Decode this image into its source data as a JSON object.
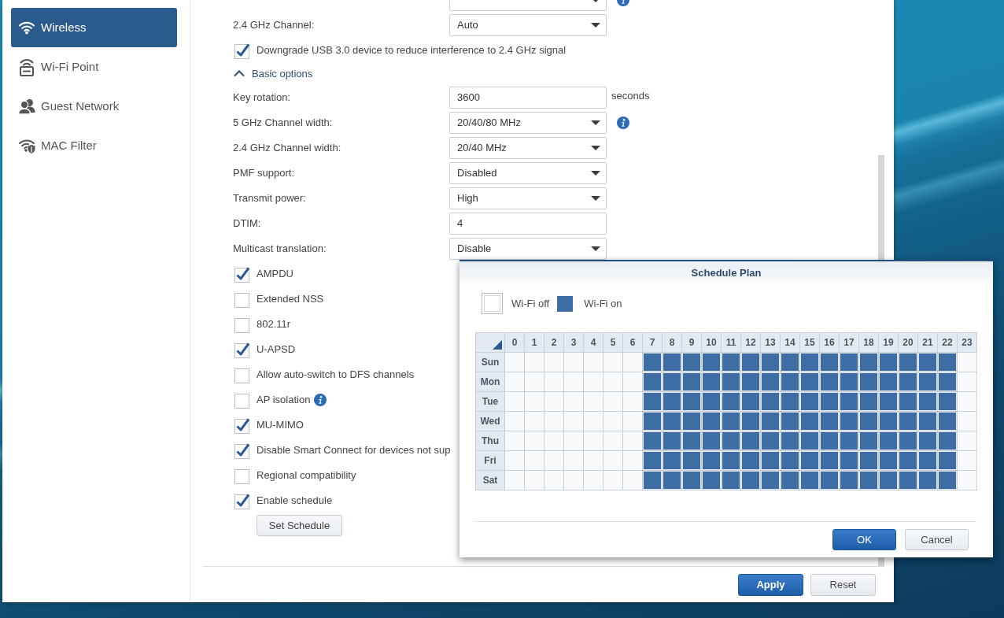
{
  "sidebar": {
    "items": [
      {
        "label": "Wireless",
        "kind": "wireless",
        "selected": true
      },
      {
        "label": "Wi-Fi Point",
        "kind": "point",
        "selected": false
      },
      {
        "label": "Guest Network",
        "kind": "guest",
        "selected": false
      },
      {
        "label": "MAC Filter",
        "kind": "filter",
        "selected": false
      }
    ]
  },
  "settings": {
    "items": [
      {
        "kind": "select",
        "info": true
      },
      {
        "kind": "select",
        "label": "2.4 GHz Channel:",
        "value": "Auto"
      },
      {
        "kind": "checkbox",
        "label": "Downgrade USB 3.0 device to reduce interference to 2.4 GHz signal",
        "checked": true
      },
      {
        "kind": "section",
        "label": "Basic options",
        "expanded": true
      },
      {
        "kind": "input",
        "label": "Key rotation:",
        "value": "3600",
        "unit": "seconds"
      },
      {
        "kind": "select",
        "label": "5 GHz Channel width:",
        "value": "20/40/80 MHz",
        "info": true
      },
      {
        "kind": "select",
        "label": "2.4 GHz Channel width:",
        "value": "20/40 MHz"
      },
      {
        "kind": "select",
        "label": "PMF support:",
        "value": "Disabled"
      },
      {
        "kind": "select",
        "label": "Transmit power:",
        "value": "High"
      },
      {
        "kind": "input",
        "label": "DTIM:",
        "value": "4"
      },
      {
        "kind": "select",
        "label": "Multicast translation:",
        "value": "Disable"
      },
      {
        "kind": "checkbox",
        "label": "AMPDU",
        "checked": true
      },
      {
        "kind": "checkbox",
        "label": "Extended NSS",
        "checked": false
      },
      {
        "kind": "checkbox",
        "label": "802.11r",
        "checked": false
      },
      {
        "kind": "checkbox",
        "label": "U-APSD",
        "checked": true
      },
      {
        "kind": "checkbox",
        "label": "Allow auto-switch to DFS channels",
        "checked": false
      },
      {
        "kind": "checkbox",
        "label": "AP isolation",
        "checked": false,
        "info": true
      },
      {
        "kind": "checkbox",
        "label": "MU-MIMO",
        "checked": true
      },
      {
        "kind": "checkbox",
        "label": "Disable Smart Connect for devices not sup",
        "checked": true
      },
      {
        "kind": "checkbox",
        "label": "Regional compatibility",
        "checked": false
      },
      {
        "kind": "checkbox",
        "label": "Enable schedule",
        "checked": true
      },
      {
        "kind": "button",
        "label": "Set Schedule"
      }
    ]
  },
  "footer": {
    "buttons": [
      {
        "label": "Apply",
        "kind": "primary"
      },
      {
        "label": "Reset",
        "kind": "secondary"
      }
    ]
  },
  "schedule_dialog": {
    "title": "Schedule Plan",
    "legend": [
      {
        "label": "Wi-Fi off",
        "on": false
      },
      {
        "label": "Wi-Fi on",
        "on": true
      }
    ],
    "hours": [
      "0",
      "1",
      "2",
      "3",
      "4",
      "5",
      "6",
      "7",
      "8",
      "9",
      "10",
      "11",
      "12",
      "13",
      "14",
      "15",
      "16",
      "17",
      "18",
      "19",
      "20",
      "21",
      "22",
      "23"
    ],
    "days": [
      {
        "label": "Sun",
        "hours": [
          false,
          false,
          false,
          false,
          false,
          false,
          false,
          true,
          true,
          true,
          true,
          true,
          true,
          true,
          true,
          true,
          true,
          true,
          true,
          true,
          true,
          true,
          true,
          false
        ]
      },
      {
        "label": "Mon",
        "hours": [
          false,
          false,
          false,
          false,
          false,
          false,
          false,
          true,
          true,
          true,
          true,
          true,
          true,
          true,
          true,
          true,
          true,
          true,
          true,
          true,
          true,
          true,
          true,
          false
        ]
      },
      {
        "label": "Tue",
        "hours": [
          false,
          false,
          false,
          false,
          false,
          false,
          false,
          true,
          true,
          true,
          true,
          true,
          true,
          true,
          true,
          true,
          true,
          true,
          true,
          true,
          true,
          true,
          true,
          false
        ]
      },
      {
        "label": "Wed",
        "hours": [
          false,
          false,
          false,
          false,
          false,
          false,
          false,
          true,
          true,
          true,
          true,
          true,
          true,
          true,
          true,
          true,
          true,
          true,
          true,
          true,
          true,
          true,
          true,
          false
        ]
      },
      {
        "label": "Thu",
        "hours": [
          false,
          false,
          false,
          false,
          false,
          false,
          false,
          true,
          true,
          true,
          true,
          true,
          true,
          true,
          true,
          true,
          true,
          true,
          true,
          true,
          true,
          true,
          true,
          false
        ]
      },
      {
        "label": "Fri",
        "hours": [
          false,
          false,
          false,
          false,
          false,
          false,
          false,
          true,
          true,
          true,
          true,
          true,
          true,
          true,
          true,
          true,
          true,
          true,
          true,
          true,
          true,
          true,
          true,
          false
        ]
      },
      {
        "label": "Sat",
        "hours": [
          false,
          false,
          false,
          false,
          false,
          false,
          false,
          true,
          true,
          true,
          true,
          true,
          true,
          true,
          true,
          true,
          true,
          true,
          true,
          true,
          true,
          true,
          true,
          false
        ]
      }
    ],
    "buttons": [
      {
        "label": "OK",
        "kind": "primary"
      },
      {
        "label": "Cancel",
        "kind": "secondary"
      }
    ]
  }
}
